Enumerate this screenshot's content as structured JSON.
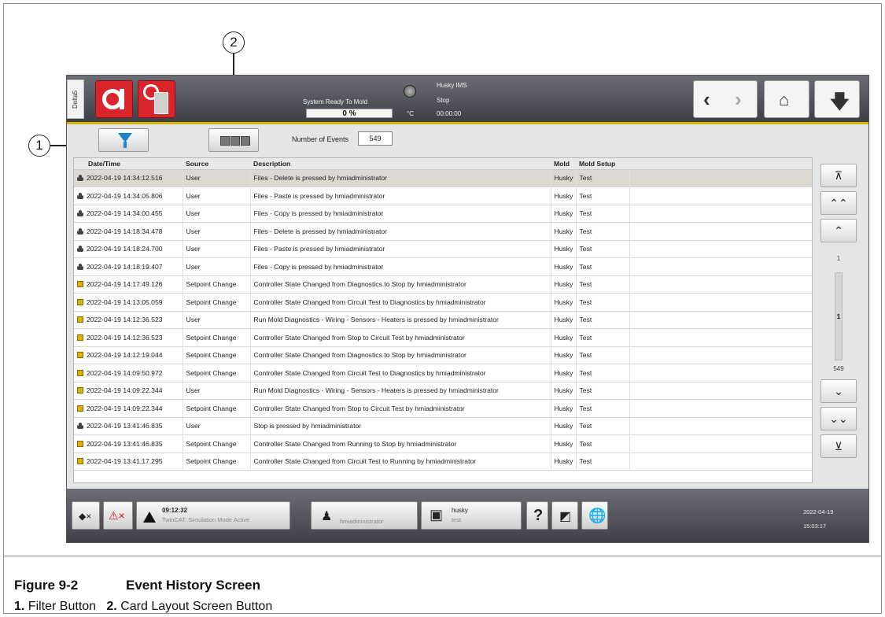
{
  "callouts": [
    "1",
    "2"
  ],
  "topbar": {
    "side_tab": "Delta5",
    "status": "System Ready To Mold",
    "progress": "0 %",
    "system_name": "Husky IMS",
    "system_state": "Stop",
    "unit": "°C",
    "timer": "00:00:00"
  },
  "toolbar": {
    "events_label": "Number of Events",
    "events_count": "549"
  },
  "table": {
    "columns": [
      "Date/Time",
      "Source",
      "Description",
      "Mold",
      "Mold Setup"
    ],
    "rows": [
      {
        "icon": "user",
        "date": "2022-04-19 14:34:12.516",
        "source": "User",
        "description": "Files - Delete is pressed by hmiadministrator",
        "mold": "Husky",
        "setup": "Test"
      },
      {
        "icon": "user",
        "date": "2022-04-19 14:34:05.806",
        "source": "User",
        "description": "Files - Paste is pressed by hmiadministrator",
        "mold": "Husky",
        "setup": "Test"
      },
      {
        "icon": "user",
        "date": "2022-04-19 14:34:00.455",
        "source": "User",
        "description": "Files - Copy is pressed by hmiadministrator",
        "mold": "Husky",
        "setup": "Test"
      },
      {
        "icon": "user",
        "date": "2022-04-19 14:18:34.478",
        "source": "User",
        "description": "Files - Delete is pressed by hmiadministrator",
        "mold": "Husky",
        "setup": "Test"
      },
      {
        "icon": "user",
        "date": "2022-04-19 14:18:24.700",
        "source": "User",
        "description": "Files - Paste is pressed by hmiadministrator",
        "mold": "Husky",
        "setup": "Test"
      },
      {
        "icon": "user",
        "date": "2022-04-19 14:18:19.407",
        "source": "User",
        "description": "Files - Copy is pressed by hmiadministrator",
        "mold": "Husky",
        "setup": "Test"
      },
      {
        "icon": "setpoint",
        "date": "2022-04-19 14:17:49.126",
        "source": "Setpoint Change",
        "description": "Controller State Changed from Diagnostics to Stop  by hmiadministrator",
        "mold": "Husky",
        "setup": "Test"
      },
      {
        "icon": "setpoint",
        "date": "2022-04-19 14:13:05.059",
        "source": "Setpoint Change",
        "description": "Controller State Changed from Circuit Test to Diagnostics  by hmiadministrator",
        "mold": "Husky",
        "setup": "Test"
      },
      {
        "icon": "setpoint",
        "date": "2022-04-19 14:12:36.523",
        "source": "User",
        "description": "Run Mold Diagnostics - Wiring - Sensors - Heaters is pressed by hmiadministrator",
        "mold": "Husky",
        "setup": "Test"
      },
      {
        "icon": "setpoint",
        "date": "2022-04-19 14:12:36.523",
        "source": "Setpoint Change",
        "description": "Controller State Changed from Stop to Circuit Test  by hmiadministrator",
        "mold": "Husky",
        "setup": "Test"
      },
      {
        "icon": "setpoint",
        "date": "2022-04-19 14:12:19.044",
        "source": "Setpoint Change",
        "description": "Controller State Changed from Diagnostics to Stop  by hmiadministrator",
        "mold": "Husky",
        "setup": "Test"
      },
      {
        "icon": "setpoint",
        "date": "2022-04-19 14:09:50.972",
        "source": "Setpoint Change",
        "description": "Controller State Changed from Circuit Test to Diagnostics  by hmiadministrator",
        "mold": "Husky",
        "setup": "Test"
      },
      {
        "icon": "setpoint",
        "date": "2022-04-19 14:09:22.344",
        "source": "User",
        "description": "Run Mold Diagnostics - Wiring - Sensors - Heaters is pressed by hmiadministrator",
        "mold": "Husky",
        "setup": "Test"
      },
      {
        "icon": "setpoint",
        "date": "2022-04-19 14:09:22.344",
        "source": "Setpoint Change",
        "description": "Controller State Changed from Stop to Circuit Test  by hmiadministrator",
        "mold": "Husky",
        "setup": "Test"
      },
      {
        "icon": "user",
        "date": "2022-04-19 13:41:46.835",
        "source": "User",
        "description": "Stop is pressed by hmiadministrator",
        "mold": "Husky",
        "setup": "Test"
      },
      {
        "icon": "setpoint",
        "date": "2022-04-19 13:41:46.835",
        "source": "Setpoint Change",
        "description": "Controller State Changed from Running to Stop  by hmiadministrator",
        "mold": "Husky",
        "setup": "Test"
      },
      {
        "icon": "setpoint",
        "date": "2022-04-19 13:41:17.295",
        "source": "Setpoint Change",
        "description": "Controller State Changed from Circuit Test to Running  by hmiadministrator",
        "mold": "Husky",
        "setup": "Test"
      }
    ]
  },
  "scroll": {
    "top": "1",
    "current": "1",
    "bottom": "549"
  },
  "bottombar": {
    "alarm_time": "09:12:32",
    "alarm_text": "TwinCAT: Simulation Mode Active",
    "user": "hmiadministrator",
    "mold_name": "husky",
    "mold_setup": "test",
    "help": "?",
    "date": "2022-04-19",
    "time": "15:03:17"
  },
  "caption": {
    "figure_number": "Figure 9-2",
    "figure_title": "Event History Screen",
    "item1_num": "1.",
    "item1_label": "Filter Button",
    "item2_num": "2.",
    "item2_label": "Card Layout Screen Button"
  }
}
